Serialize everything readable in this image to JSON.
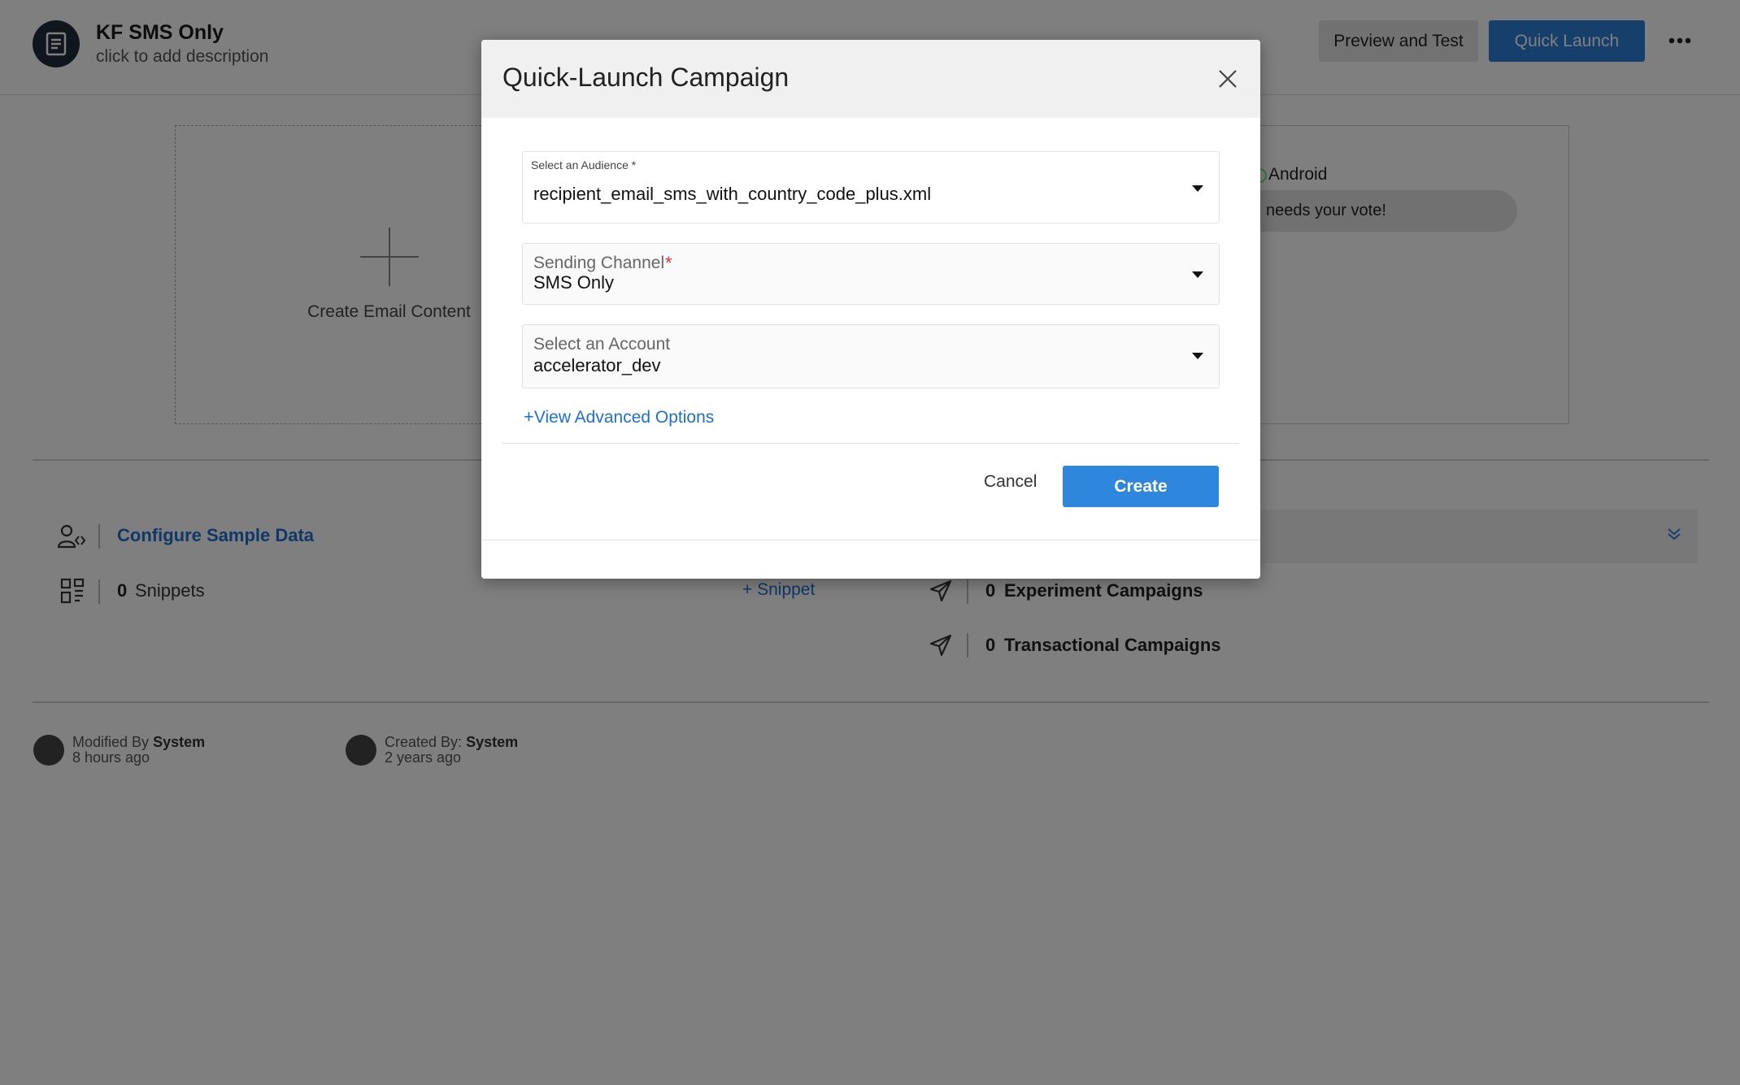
{
  "header": {
    "title": "KF SMS Only",
    "description": "click to add description",
    "preview_label": "Preview and Test",
    "quick_launch_label": "Quick Launch"
  },
  "content": {
    "create_email_label": "Create Email Content",
    "android_label": "Android",
    "vote_text": "needs your vote!"
  },
  "panels": {
    "sample_data_label": "Configure Sample Data",
    "snippets_count": "0",
    "snippets_label": "Snippets",
    "add_snippet_label": "+ Snippet",
    "experiment_count": "0",
    "experiment_label": "Experiment Campaigns",
    "transactional_count": "0",
    "transactional_label": "Transactional Campaigns"
  },
  "meta": {
    "modified_prefix": "Modified By",
    "modified_by": "System",
    "modified_time": "8 hours ago",
    "created_prefix": "Created By:",
    "created_by": "System",
    "created_time": "2 years ago"
  },
  "modal": {
    "title": "Quick-Launch Campaign",
    "audience_label": "Select an Audience *",
    "audience_value": "recipient_email_sms_with_country_code_plus.xml",
    "channel_label": "Sending Channel",
    "channel_required": "*",
    "channel_value": "SMS Only",
    "account_label": "Select an Account",
    "account_value": "accelerator_dev",
    "advanced_label": "View Advanced Options",
    "cancel_label": "Cancel",
    "create_label": "Create"
  },
  "colors": {
    "primary": "#2f7fd8",
    "link": "#1e6fd0",
    "required": "#dd3333",
    "overlay": "rgba(0,0,0,0.5)"
  },
  "icons": [
    "document-icon",
    "more-icon",
    "plus-icon",
    "user-code-icon",
    "snippet-icon",
    "send-icon",
    "chevron-down-double-icon",
    "close-icon",
    "caret-down-icon"
  ]
}
